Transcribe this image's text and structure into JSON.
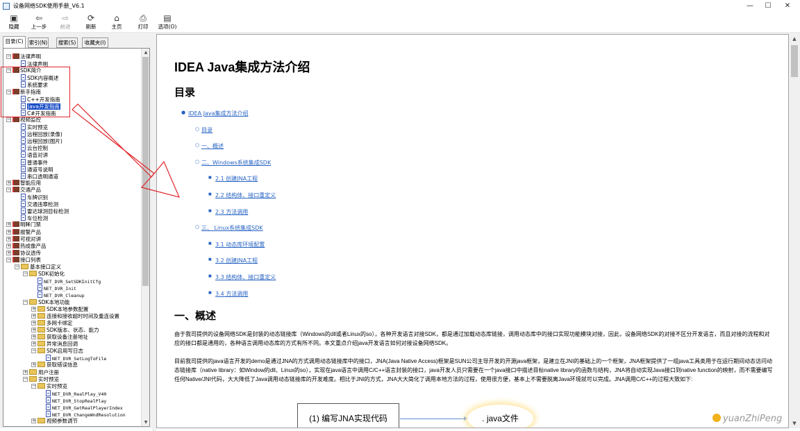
{
  "window": {
    "title": "设备网络SDK使用手册_V6.1",
    "minimize": "—",
    "maximize": "☐",
    "close": "✕",
    "accent": "#e0262c"
  },
  "toolbar": {
    "items": [
      {
        "label": "隐藏",
        "icon": "hide-icon",
        "glyph": "▣"
      },
      {
        "label": "上一步",
        "icon": "back-arrow-icon",
        "glyph": "⇦"
      },
      {
        "label": "前进",
        "icon": "forward-arrow-icon",
        "glyph": "⇨"
      },
      {
        "label": "刷新",
        "icon": "refresh-icon",
        "glyph": "⟳"
      },
      {
        "label": "主页",
        "icon": "home-icon",
        "glyph": "⌂"
      },
      {
        "label": "打印",
        "icon": "print-icon",
        "glyph": "⎙"
      },
      {
        "label": "选项(O)",
        "icon": "options-icon",
        "glyph": "▤"
      }
    ]
  },
  "nav_tabs": [
    "目录(C)",
    "索引(N)",
    "搜索(S)",
    "收藏夹(I)"
  ],
  "tree": [
    {
      "label": "法律声明",
      "type": "book",
      "exp": "−",
      "lvl": 0
    },
    {
      "label": "法律声明",
      "type": "page",
      "lvl": 1
    },
    {
      "label": "SDK简介",
      "type": "book",
      "exp": "−",
      "lvl": 0
    },
    {
      "label": "SDK内容概述",
      "type": "page",
      "lvl": 1
    },
    {
      "label": "系统要求",
      "type": "page",
      "lvl": 1
    },
    {
      "label": "新手指南",
      "type": "book",
      "exp": "−",
      "lvl": 0
    },
    {
      "label": "C++开发指南",
      "type": "page",
      "lvl": 1
    },
    {
      "label": "Java开发指南",
      "type": "page",
      "lvl": 1,
      "sel": true
    },
    {
      "label": "C#开发指南",
      "type": "page",
      "lvl": 1
    },
    {
      "label": "视频监控",
      "type": "book",
      "exp": "−",
      "lvl": 0
    },
    {
      "label": "实时预览",
      "type": "page",
      "lvl": 1
    },
    {
      "label": "远程回放(录像)",
      "type": "page",
      "lvl": 1
    },
    {
      "label": "远程回放(图片)",
      "type": "page",
      "lvl": 1
    },
    {
      "label": "云台控制",
      "type": "page",
      "lvl": 1
    },
    {
      "label": "语音对讲",
      "type": "page",
      "lvl": 1
    },
    {
      "label": "普通事件",
      "type": "page",
      "lvl": 1
    },
    {
      "label": "通道号说明",
      "type": "page",
      "lvl": 1
    },
    {
      "label": "串口透明通道",
      "type": "page",
      "lvl": 1
    },
    {
      "label": "智能应用",
      "type": "book",
      "exp": "+",
      "lvl": 0
    },
    {
      "label": "交通产品",
      "type": "book",
      "exp": "−",
      "lvl": 0
    },
    {
      "label": "车牌识别",
      "type": "page",
      "lvl": 1
    },
    {
      "label": "交通违章检测",
      "type": "page",
      "lvl": 1
    },
    {
      "label": "雷达球测目标检测",
      "type": "page",
      "lvl": 1
    },
    {
      "label": "车位检测",
      "type": "page",
      "lvl": 1
    },
    {
      "label": "明眸门禁",
      "type": "book",
      "exp": "+",
      "lvl": 0
    },
    {
      "label": "报警产品",
      "type": "book",
      "exp": "+",
      "lvl": 0
    },
    {
      "label": "可视对讲",
      "type": "book",
      "exp": "+",
      "lvl": 0
    },
    {
      "label": "热成像产品",
      "type": "book",
      "exp": "+",
      "lvl": 0
    },
    {
      "label": "协议透传",
      "type": "book",
      "exp": "+",
      "lvl": 0
    },
    {
      "label": "接口列表",
      "type": "book",
      "exp": "−",
      "lvl": 0
    },
    {
      "label": "基本接口定义",
      "type": "folder",
      "exp": "−",
      "lvl": 1
    },
    {
      "label": "SDK初始化",
      "type": "folder",
      "exp": "−",
      "lvl": 2
    },
    {
      "label": "NET_DVR_SetSDKInitCfg",
      "type": "page",
      "lvl": 3,
      "mono": true
    },
    {
      "label": "NET_DVR_Init",
      "type": "page",
      "lvl": 3,
      "mono": true
    },
    {
      "label": "NET_DVR_Cleanup",
      "type": "page",
      "lvl": 3,
      "mono": true
    },
    {
      "label": "SDK本地功能",
      "type": "folder",
      "exp": "−",
      "lvl": 2
    },
    {
      "label": "SDK本地参数配置",
      "type": "folder",
      "exp": "+",
      "lvl": 3
    },
    {
      "label": "连接和接收超时时间及重连设置",
      "type": "folder",
      "exp": "+",
      "lvl": 3
    },
    {
      "label": "多网卡绑定",
      "type": "folder",
      "exp": "+",
      "lvl": 3
    },
    {
      "label": "SDK版本、状态、能力",
      "type": "folder",
      "exp": "+",
      "lvl": 3
    },
    {
      "label": "获取设备注册地址",
      "type": "folder",
      "exp": "+",
      "lvl": 3
    },
    {
      "label": "异常消息回调",
      "type": "folder",
      "exp": "+",
      "lvl": 3
    },
    {
      "label": "SDK启用写日志",
      "type": "folder",
      "exp": "−",
      "lvl": 3
    },
    {
      "label": "NET_DVR_SetLogToFile",
      "type": "page",
      "lvl": 4,
      "mono": true
    },
    {
      "label": "获取错误信息",
      "type": "folder",
      "exp": "+",
      "lvl": 3
    },
    {
      "label": "用户注册",
      "type": "folder",
      "exp": "+",
      "lvl": 2
    },
    {
      "label": "实时预览",
      "type": "folder",
      "exp": "−",
      "lvl": 2
    },
    {
      "label": "实时预览",
      "type": "folder",
      "exp": "−",
      "lvl": 3
    },
    {
      "label": "NET_DVR_RealPlay_V40",
      "type": "page",
      "lvl": 4,
      "mono": true
    },
    {
      "label": "NET_DVR_StopRealPlay",
      "type": "page",
      "lvl": 4,
      "mono": true
    },
    {
      "label": "NET_DVR_GetRealPlayerIndex",
      "type": "page",
      "lvl": 4,
      "mono": true
    },
    {
      "label": "NET_DVR_ChangeWndResolution",
      "type": "page",
      "lvl": 4,
      "mono": true
    },
    {
      "label": "视频参数调节",
      "type": "folder",
      "exp": "+",
      "lvl": 3
    }
  ],
  "doc": {
    "title": "IDEA Java集成方法介绍",
    "toc_heading": "目录",
    "toc": [
      {
        "text": "IDEA Java集成方法介绍",
        "lvl": 0
      },
      {
        "text": "目录",
        "lvl": 1
      },
      {
        "text": "一、概述",
        "lvl": 1
      },
      {
        "text": "二、Windows系统集成SDK",
        "lvl": 1
      },
      {
        "text": "2.1 创建JNA工程",
        "lvl": 2
      },
      {
        "text": "2.2 结构体、接口重定义",
        "lvl": 2
      },
      {
        "text": "2.3 方法调用",
        "lvl": 2
      },
      {
        "text": "三、 Linux系统集成SDK",
        "lvl": 1
      },
      {
        "text": "3.1 动态库环境配置",
        "lvl": 2
      },
      {
        "text": "3.2 创建JNA工程",
        "lvl": 2
      },
      {
        "text": "3.3 结构体、接口重定义",
        "lvl": 2
      },
      {
        "text": "3.4 方法调用",
        "lvl": 2
      }
    ],
    "section1": "一、概述",
    "para1": "由于我司提供的设备网络SDK是封装的动态链接库（Windows的dll或者Linux的so），各种开发语言对接SDK，都是通过加载动态库链接，调用动态库中的接口实现功能模块对接，因此，设备网络SDK的对接不区分开发语言，而且对接的流程和对应的接口都是通用的，各种语言调用动态库的方式有所不同。本文重点介绍java开发语言如何对接设备网络SDK。",
    "para2": "目前我司提供的java语言开发的demo是通过JNA的方式调用动态链接库中的接口，JNA(Java Native Access)框架是SUN公司主导开发的开源java框架，是建立在JNI的基础上的一个框架，JNA框架提供了一组java工具类用于在运行期间动态访问动态链接库（native library：如Window的dll、Linux的so），实现在java语言中调用C/C++语言封装的接口，java开发人员只需要在一个java接口中描述目标native library的函数与结构，JNA将自动实现Java接口到native function的映射，而不需要编写任何Native/JNI代码，大大降低了Java调用动态链接库的开发难度。相比于JNI的方式，JNA大大简化了调用本地方法的过程，使用很方便，基本上不需要脱离Java环境就可以完成。JNA调用C/C++的过程大致如下:",
    "flow_box": "(1) 编写JNA实现代码",
    "flow_oval": ". java文件"
  },
  "watermark": "yuanZhiPeng"
}
